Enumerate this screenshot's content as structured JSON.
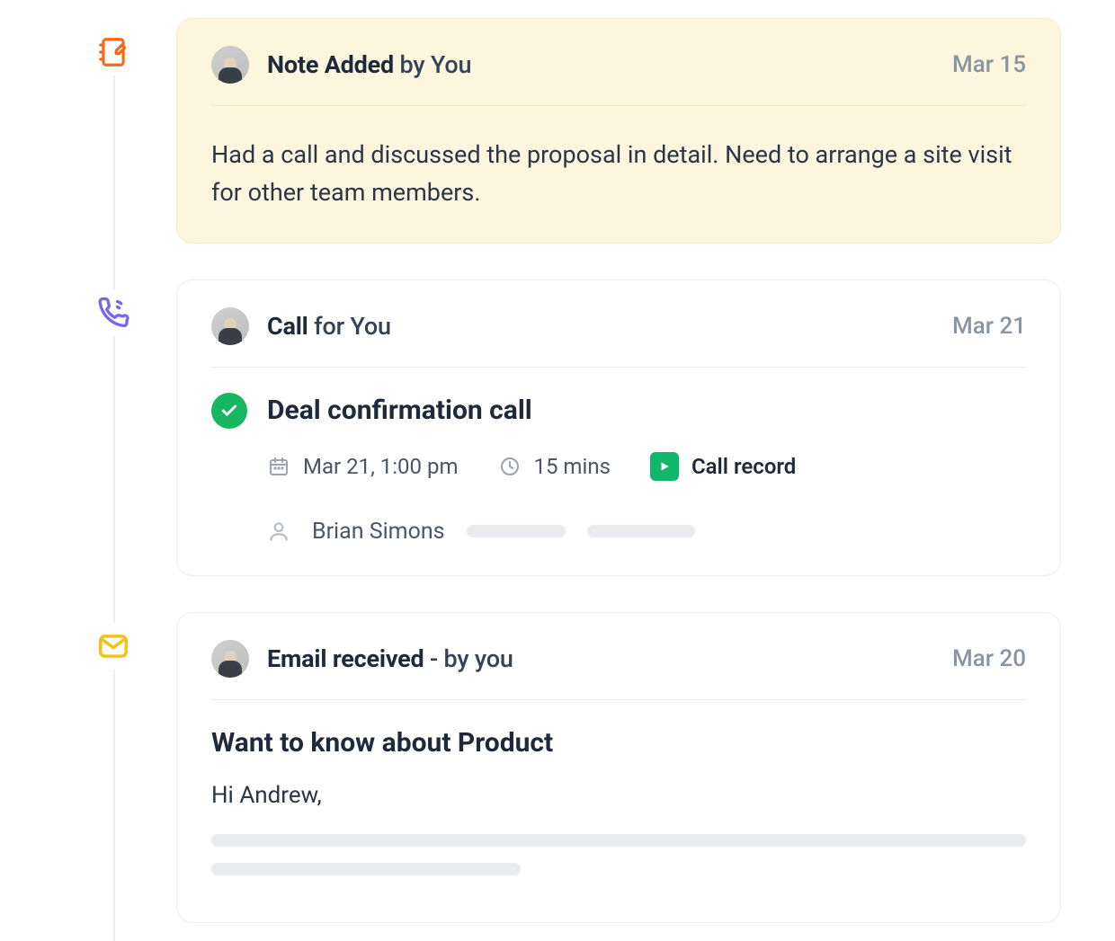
{
  "entries": [
    {
      "icon": "note",
      "title_strong": "Note Added",
      "title_rest": " by You",
      "date": "Mar 15",
      "body_text": "Had a call and discussed the proposal in detail. Need to arrange a site visit for other team members."
    },
    {
      "icon": "call",
      "title_strong": "Call",
      "title_rest": " for You",
      "date": "Mar 21",
      "call": {
        "subject": "Deal confirmation call",
        "datetime_text": "Mar 21, 1:00 pm",
        "duration_text": "15 mins",
        "record_label": "Call record",
        "attendee_name": "Brian Simons"
      }
    },
    {
      "icon": "email",
      "title_strong": "Email received",
      "title_rest": " - by you",
      "date": "Mar 20",
      "email": {
        "subject": "Want to know about Product",
        "greeting": "Hi Andrew,"
      }
    }
  ],
  "colors": {
    "note_icon": "#f26a1b",
    "call_icon": "#7a63f0",
    "email_icon": "#f0c31a",
    "success": "#17b661",
    "play": "#0fb76b"
  }
}
